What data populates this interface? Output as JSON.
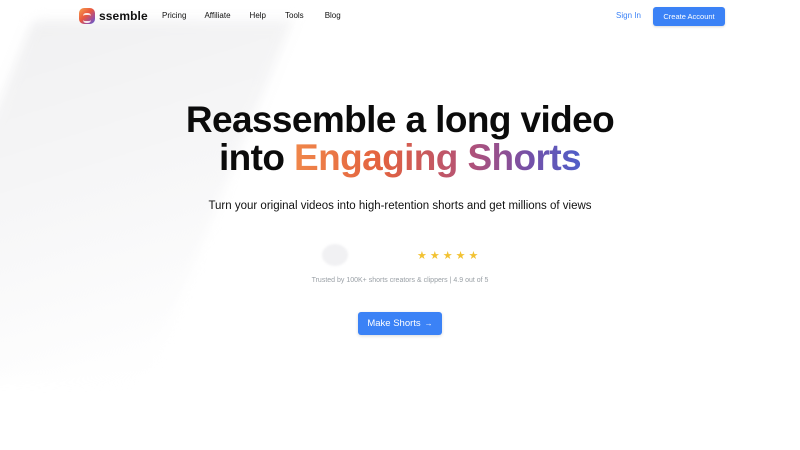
{
  "brand": {
    "name": "ssemble",
    "logo_icon": "ssemble-logo-icon"
  },
  "nav": {
    "links": [
      "Pricing",
      "Affiliate",
      "Help",
      "Tools",
      "Blog"
    ],
    "sign_in": "Sign In",
    "create_account": "Create Account"
  },
  "hero": {
    "headline_line1": "Reassemble a long video",
    "headline_prefix": "into ",
    "headline_gradient": "Engaging Shorts",
    "subtitle": "Turn your original videos into high-retention shorts and get millions of views",
    "rating_stars": 5,
    "trust_text": "Trusted by 100K+ shorts creators & clippers | 4.9 out of 5",
    "cta_label": "Make Shorts",
    "cta_arrow": "→"
  },
  "colors": {
    "accent": "#3b82f6",
    "star": "#f2c232",
    "gradient": [
      "#f0874a",
      "#e3623f",
      "#b0517a",
      "#7450a8",
      "#4f5fc9"
    ]
  }
}
